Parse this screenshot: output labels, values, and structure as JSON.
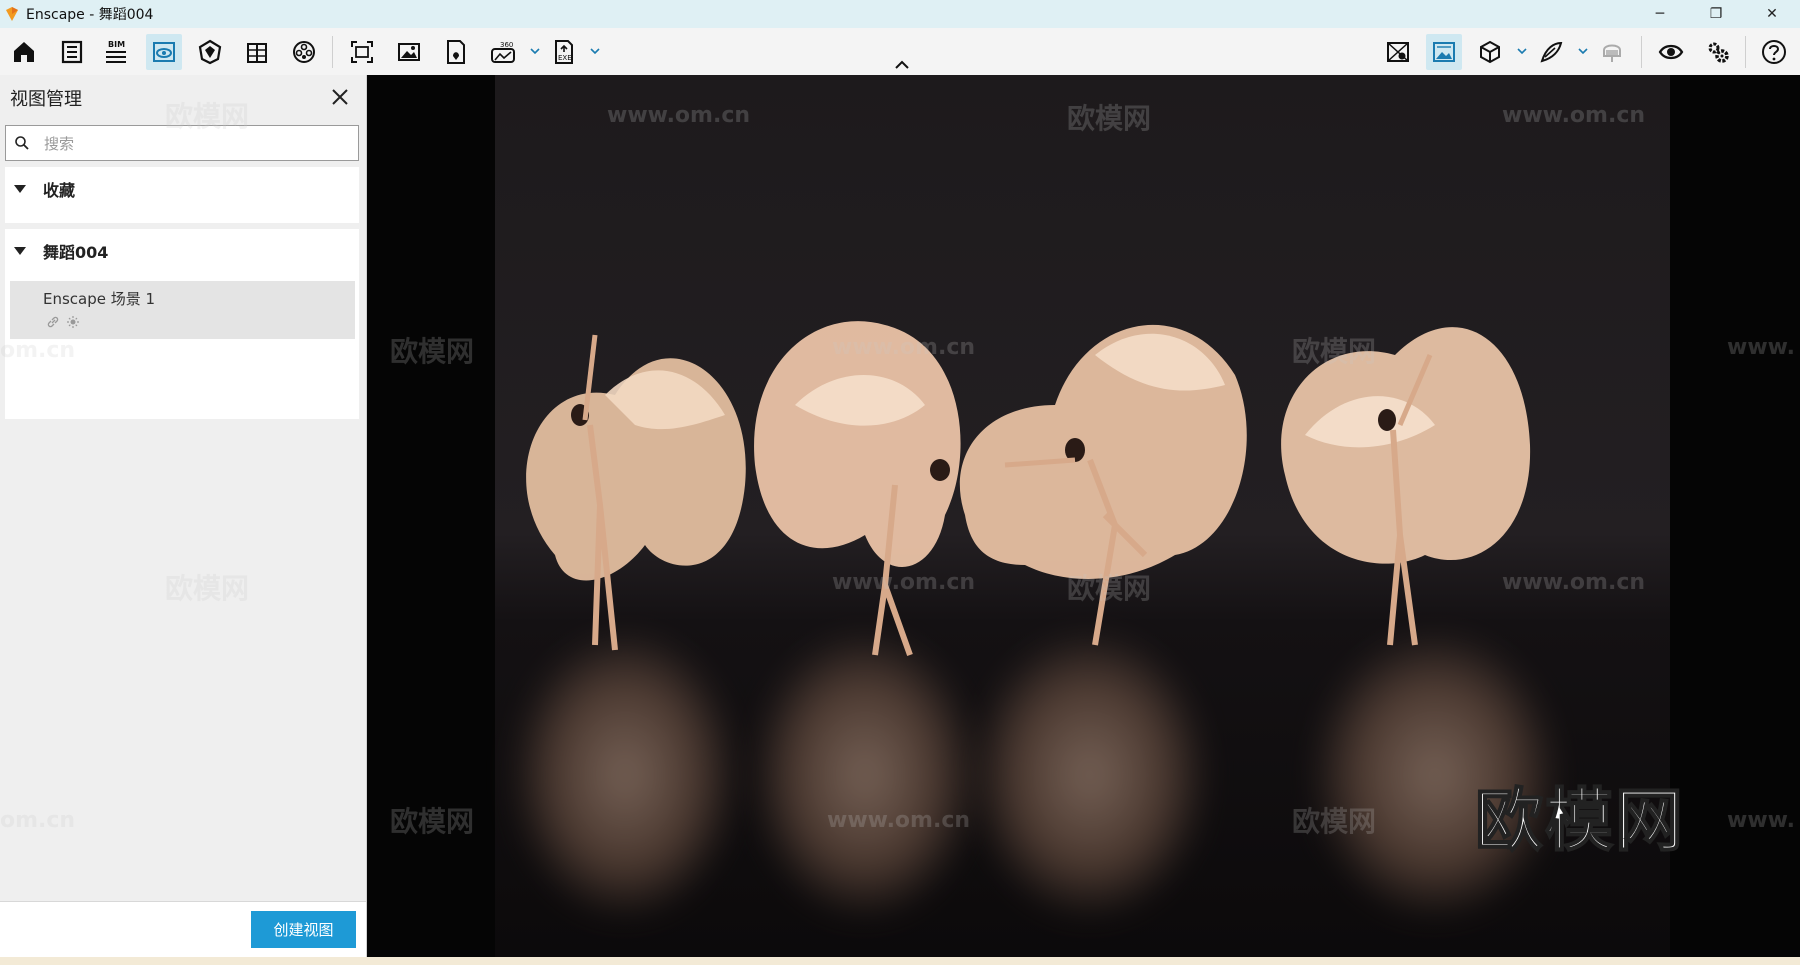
{
  "window": {
    "title": "Enscape - 舞蹈004",
    "controls": {
      "minimize": "─",
      "restore": "❐",
      "close": "✕"
    }
  },
  "toolbar": {
    "bim_label": "BIM",
    "icons": [
      "home-icon",
      "asset-library-icon",
      "bim-icon",
      "view-management-icon",
      "material-editor-icon",
      "building-icon",
      "atmosphere-icon",
      "screenshot-icon",
      "batch-render-icon",
      "panorama-icon",
      "export-360-icon",
      "export-exe-icon",
      "minimap-icon",
      "visual-settings-icon",
      "cube-icon",
      "sketch-mode-icon",
      "vr-headset-icon",
      "visibility-icon",
      "settings-icon",
      "help-icon"
    ]
  },
  "panel": {
    "title": "视图管理",
    "search_placeholder": "搜索",
    "favorites_label": "收藏",
    "project_label": "舞蹈004",
    "view_item_name": "Enscape 场景 1",
    "create_view_label": "创建视图"
  },
  "viewport": {
    "watermark_text": "欧模网",
    "watermark_url": "www.om.cn",
    "watermark_url_partial_left": "om.cn",
    "watermark_url_partial_right": "www.",
    "brand_text": "欧模网"
  },
  "colors": {
    "accent": "#1e9ad6",
    "titlebar": "#dff0f4",
    "active_tool": "#cfe8f1"
  }
}
